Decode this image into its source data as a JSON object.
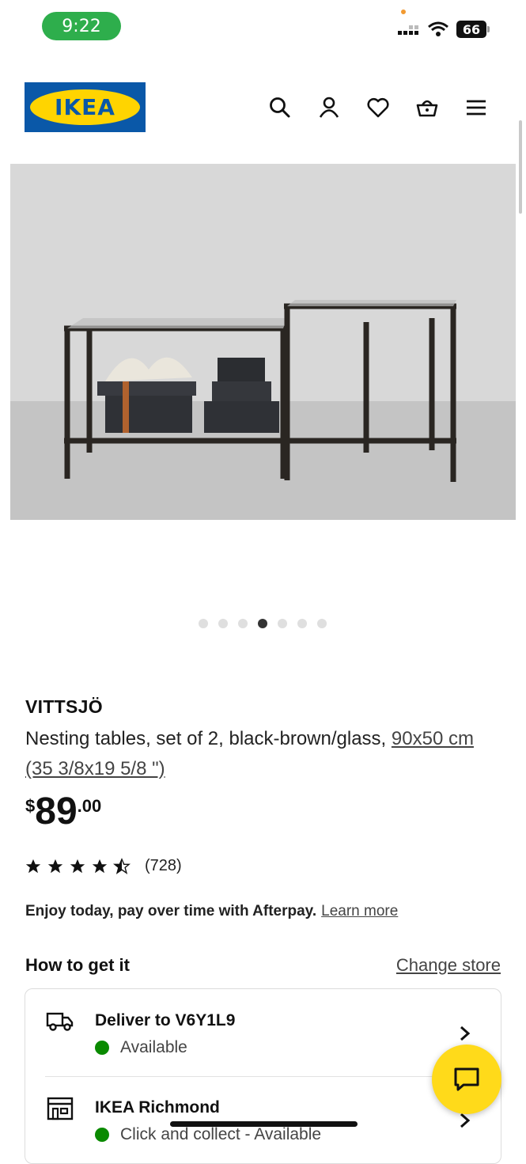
{
  "status_bar": {
    "time": "9:22",
    "battery": "66"
  },
  "header": {
    "logo_text": "IKEA"
  },
  "gallery": {
    "total_dots": 7,
    "active_index": 3
  },
  "product": {
    "name": "VITTSJÖ",
    "description": "Nesting tables, set of 2, black-brown/glass,",
    "size_link": "90x50 cm (35 3/8x19 5/8 \")",
    "price": {
      "currency": "$",
      "integer": "89",
      "decimal": ".00"
    },
    "rating": {
      "stars": 4.5,
      "count": "(728)"
    }
  },
  "afterpay": {
    "text": "Enjoy today, pay over time with Afterpay.",
    "link": "Learn more"
  },
  "how_to_get": {
    "title": "How to get it",
    "change_store": "Change store",
    "options": [
      {
        "title": "Deliver to V6Y1L9",
        "status": "Available"
      },
      {
        "title": "IKEA Richmond",
        "status": "Click and collect - Available"
      }
    ]
  },
  "colors": {
    "ikea_blue": "#0a58a8",
    "ikea_yellow": "#ffd400",
    "available_green": "#0a8a00",
    "chat_yellow": "#ffda1a"
  }
}
